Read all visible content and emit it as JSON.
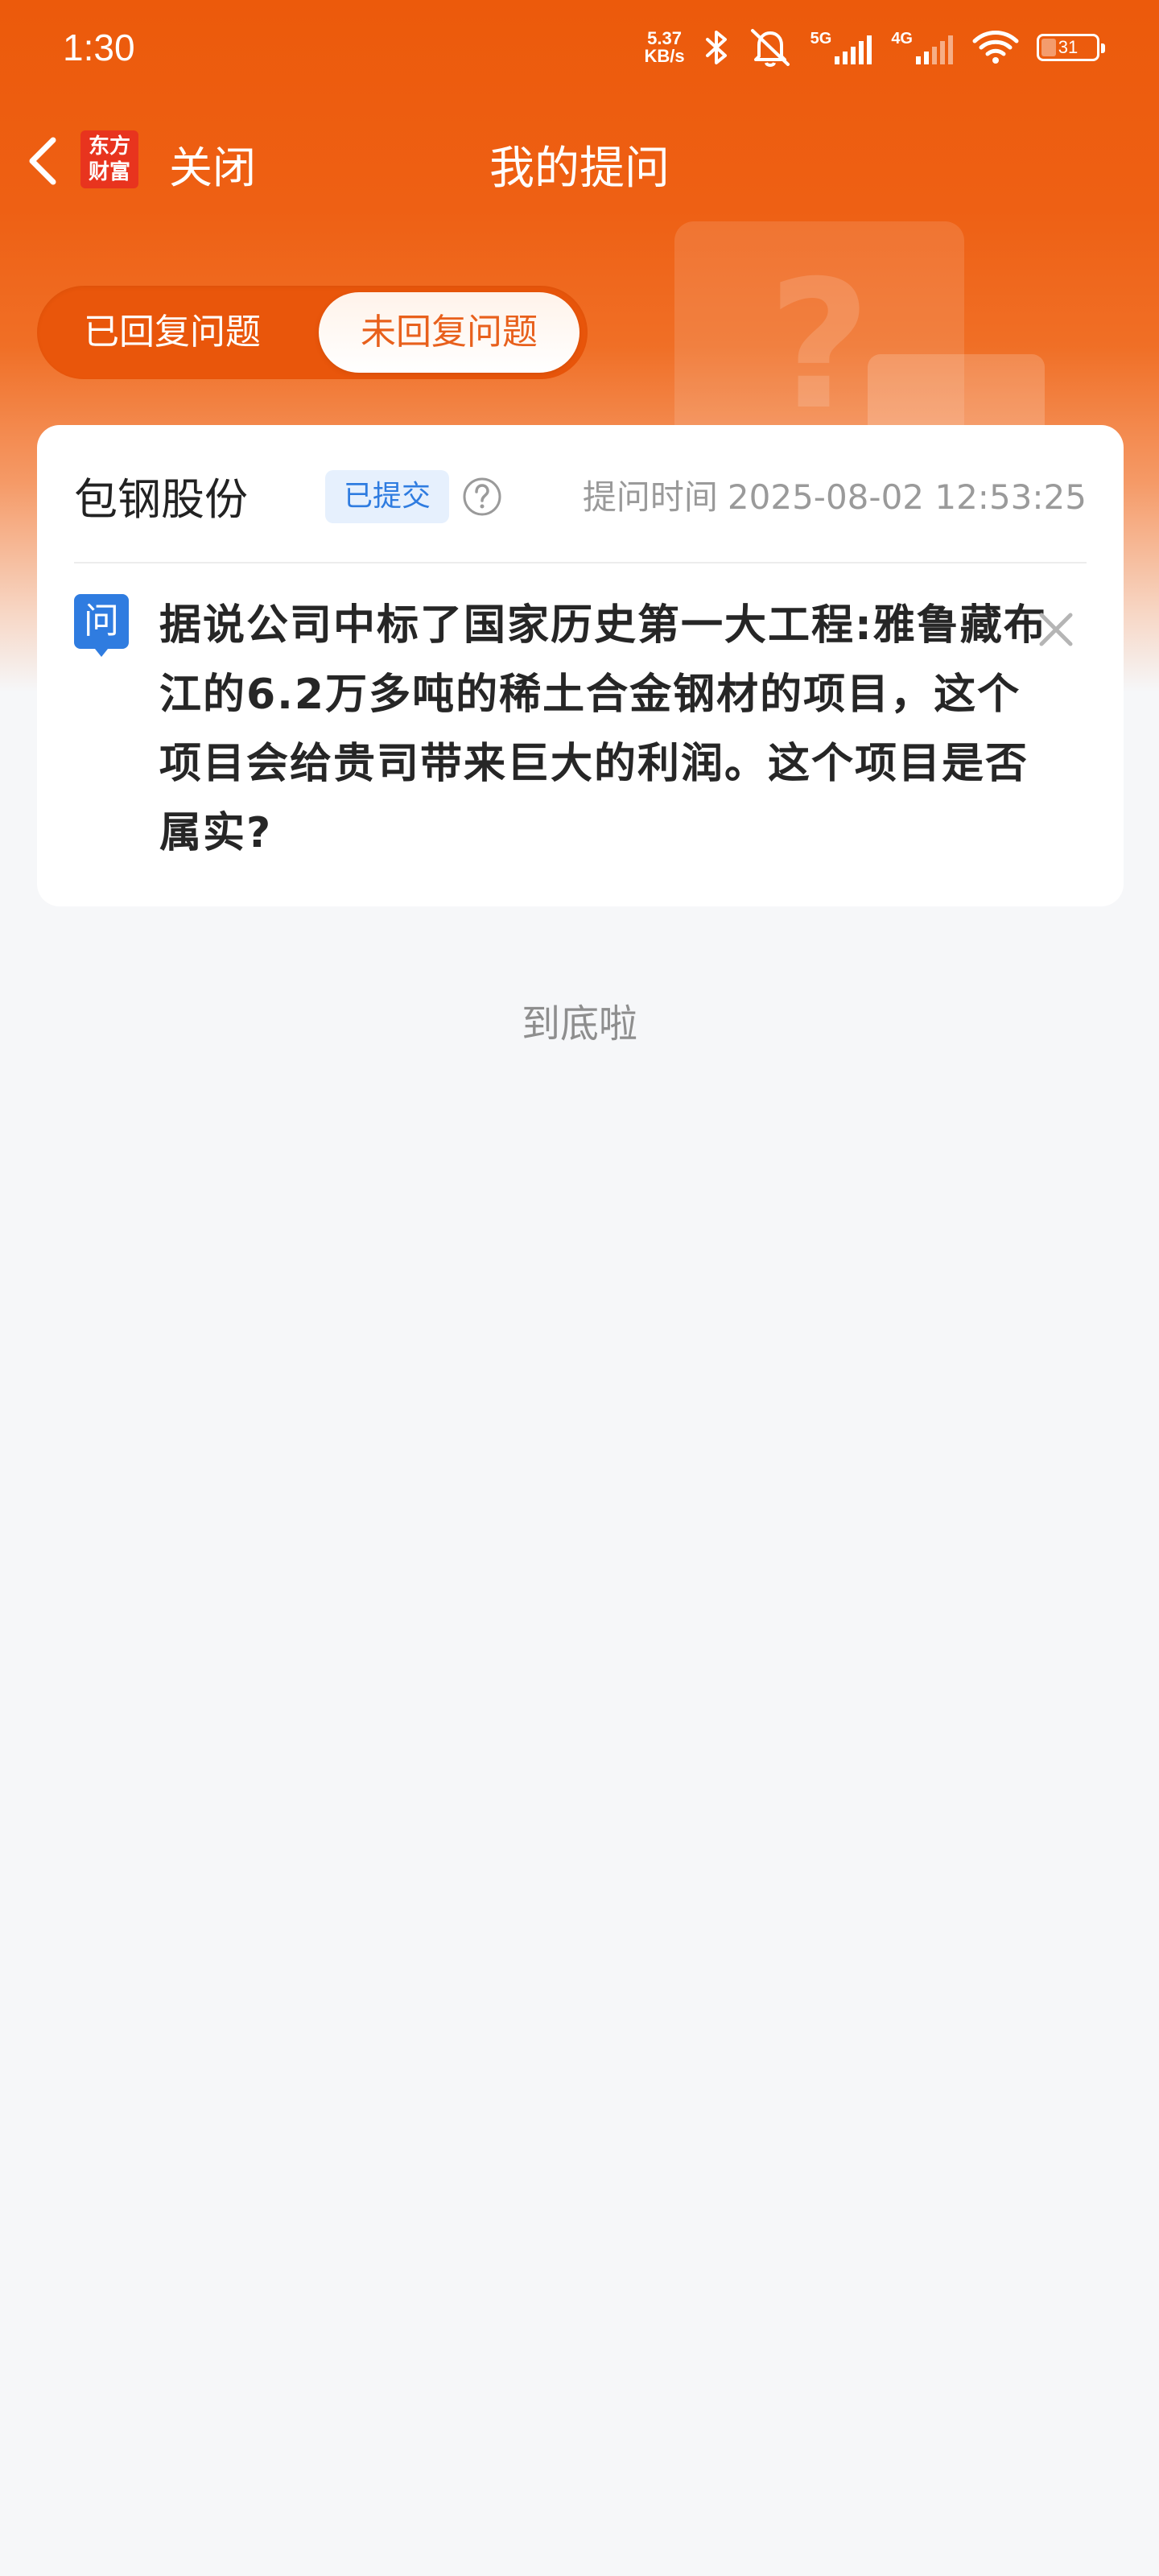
{
  "status_bar": {
    "time": "1:30",
    "net_speed_value": "5.37",
    "net_speed_unit": "KB/s",
    "signal_5g": "5G",
    "signal_4g": "4G",
    "battery_level": "31"
  },
  "nav": {
    "logo_line1": "东方",
    "logo_line2": "财富",
    "close_label": "关闭",
    "title": "我的提问"
  },
  "tabs": [
    {
      "label": "已回复问题",
      "active": false
    },
    {
      "label": "未回复问题",
      "active": true
    }
  ],
  "question": {
    "company": "包钢股份",
    "status": "已提交",
    "time_label": "提问时间",
    "time_value": "2025-08-02 12:53:25",
    "icon_label": "问",
    "text": "据说公司中标了国家历史第一大工程:雅鲁藏布江的6.2万多吨的稀土合金钢材的项目，这个项目会给贵司带来巨大的利润。这个项目是否属实?"
  },
  "footer": {
    "end_text": "到底啦"
  },
  "colors": {
    "brand": "#ec5a0b",
    "badge_bg": "#e6f0fd",
    "badge_text": "#2f7ce0",
    "active_tab_text": "#e8601c"
  }
}
